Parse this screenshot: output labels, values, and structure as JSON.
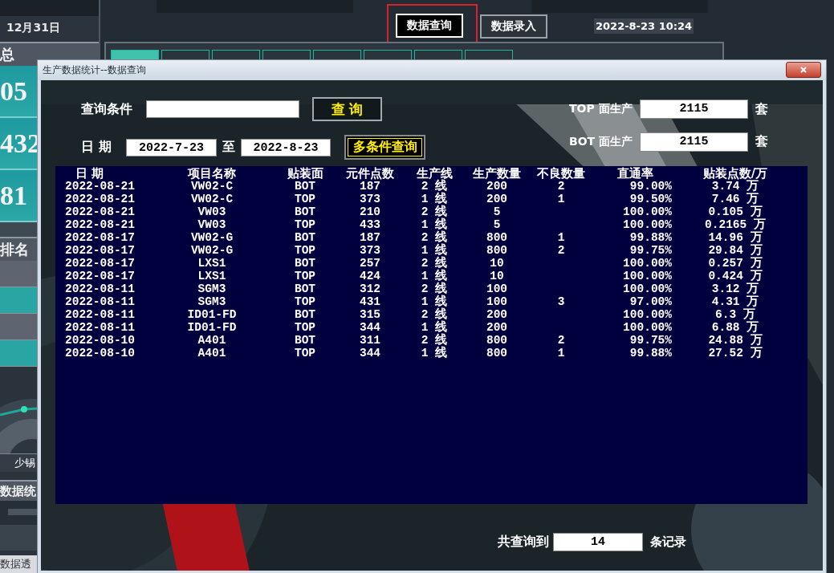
{
  "dashboard": {
    "date": "12月31日",
    "nav_buttons": [
      {
        "label": "数据查询",
        "selected": true
      },
      {
        "label": "数据录入",
        "selected": false
      }
    ],
    "datetime": "2022-8-23 10:24",
    "panel_tabs": [
      {
        "selected": true
      },
      {
        "selected": false
      },
      {
        "selected": false
      },
      {
        "selected": false
      },
      {
        "selected": false
      },
      {
        "selected": false
      },
      {
        "selected": false
      },
      {
        "selected": false
      }
    ],
    "left_panel": {
      "title": "总",
      "stats": [
        "05",
        "432",
        "81"
      ],
      "ranking_title": "排名",
      "gauge_label": "少锡",
      "section_title": "数据统",
      "footer": "数据透"
    }
  },
  "dialog": {
    "title": "生产数据统计--数据查询",
    "query_label": "查询条件",
    "search_button": "查 询",
    "date_label": "日 期",
    "date_from": "2022-7-23",
    "date_sep": "至",
    "date_to": "2022-8-23",
    "multi_button": "多条件查询",
    "top_label": "TOP 面生产",
    "top_value": "2115",
    "top_unit": "套",
    "bot_label": "BOT 面生产",
    "bot_value": "2115",
    "bot_unit": "套",
    "table": {
      "columns": [
        "日 期",
        "项目名称",
        "贴装面",
        "元件点数",
        "生产线",
        "生产数量",
        "不良数量",
        "直通率",
        "贴装点数/万"
      ],
      "rows": [
        {
          "date": "2022-08-21",
          "project": "VW02-C",
          "side": "BOT",
          "parts": "187",
          "line": "2 线",
          "qty": "200",
          "defects": "2",
          "yield": "99.00%",
          "placement": "3.74 万"
        },
        {
          "date": "2022-08-21",
          "project": "VW02-C",
          "side": "TOP",
          "parts": "373",
          "line": "1 线",
          "qty": "200",
          "defects": "1",
          "yield": "99.50%",
          "placement": "7.46 万"
        },
        {
          "date": "2022-08-21",
          "project": "VW03",
          "side": "BOT",
          "parts": "210",
          "line": "2 线",
          "qty": "5",
          "yield": "100.00%",
          "placement": "0.105 万"
        },
        {
          "date": "2022-08-21",
          "project": "VW03",
          "side": "TOP",
          "parts": "433",
          "line": "1 线",
          "qty": "5",
          "yield": "100.00%",
          "placement": "0.2165 万"
        },
        {
          "date": "2022-08-17",
          "project": "VW02-G",
          "side": "BOT",
          "parts": "187",
          "line": "2 线",
          "qty": "800",
          "defects": "1",
          "yield": "99.88%",
          "placement": "14.96 万"
        },
        {
          "date": "2022-08-17",
          "project": "VW02-G",
          "side": "TOP",
          "parts": "373",
          "line": "1 线",
          "qty": "800",
          "defects": "2",
          "yield": "99.75%",
          "placement": "29.84 万"
        },
        {
          "date": "2022-08-17",
          "project": "LXS1",
          "side": "BOT",
          "parts": "257",
          "line": "2 线",
          "qty": "10",
          "yield": "100.00%",
          "placement": "0.257 万"
        },
        {
          "date": "2022-08-17",
          "project": "LXS1",
          "side": "TOP",
          "parts": "424",
          "line": "1 线",
          "qty": "10",
          "yield": "100.00%",
          "placement": "0.424 万"
        },
        {
          "date": "2022-08-11",
          "project": "SGM3",
          "side": "BOT",
          "parts": "312",
          "line": "2 线",
          "qty": "100",
          "yield": "100.00%",
          "placement": "3.12 万"
        },
        {
          "date": "2022-08-11",
          "project": "SGM3",
          "side": "TOP",
          "parts": "431",
          "line": "1 线",
          "qty": "100",
          "defects": "3",
          "yield": "97.00%",
          "placement": "4.31 万"
        },
        {
          "date": "2022-08-11",
          "project": "ID01-FD",
          "side": "BOT",
          "parts": "315",
          "line": "2 线",
          "qty": "200",
          "yield": "100.00%",
          "placement": "6.3 万"
        },
        {
          "date": "2022-08-11",
          "project": "ID01-FD",
          "side": "TOP",
          "parts": "344",
          "line": "1 线",
          "qty": "200",
          "yield": "100.00%",
          "placement": "6.88 万"
        },
        {
          "date": "2022-08-10",
          "project": "A401",
          "side": "BOT",
          "parts": "311",
          "line": "2 线",
          "qty": "800",
          "defects": "2",
          "yield": "99.75%",
          "placement": "24.88 万"
        },
        {
          "date": "2022-08-10",
          "project": "A401",
          "side": "TOP",
          "parts": "344",
          "line": "1 线",
          "qty": "800",
          "defects": "1",
          "yield": "99.88%",
          "placement": "27.52 万"
        }
      ]
    },
    "total_label": "共查询到",
    "total_value": "14",
    "total_unit": "条记录"
  }
}
